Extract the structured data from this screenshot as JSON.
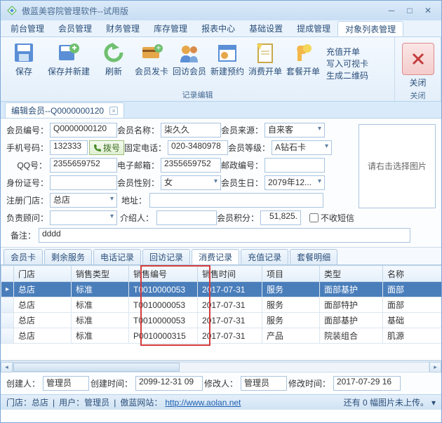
{
  "window": {
    "title": "傲蓝美容院管理软件--试用版"
  },
  "menu": [
    "前台管理",
    "会员管理",
    "财务管理",
    "库存管理",
    "报表中心",
    "基础设置",
    "提成管理",
    "对象列表管理"
  ],
  "menu_active": 7,
  "ribbon": {
    "group1_caption": "记录编辑",
    "buttons": [
      "保存",
      "保存并新建",
      "刷新",
      "会员发卡",
      "回访会员",
      "新建预约",
      "消费开单",
      "套餐开单"
    ],
    "stack": [
      "充值开单",
      "写入可视卡",
      "生成二维码"
    ],
    "close_caption": "关闭",
    "close_label": "关闭"
  },
  "doctab": {
    "title": "编辑会员--Q0000000120"
  },
  "form": {
    "labels": {
      "member_no": "会员编号：",
      "member_name": "会员名称：",
      "source": "会员来源：",
      "mobile": "手机号码：",
      "dial": "拨号",
      "phone": "固定电话：",
      "level": "会员等级：",
      "qq": "QQ号：",
      "email": "电子邮箱：",
      "zip": "邮政编号：",
      "idcard": "身份证号：",
      "gender": "会员性别：",
      "birthday": "会员生日：",
      "reg_store": "注册门店：",
      "address": "地址：",
      "consultant": "负责顾问：",
      "referrer": "介绍人：",
      "points": "会员积分：",
      "nosms": "不收短信",
      "remark": "备注："
    },
    "values": {
      "member_no": "Q0000000120",
      "member_name": "柒久久",
      "source": "自来客",
      "mobile": "132333",
      "phone": "020-3480978",
      "level": "A钻石卡",
      "qq": "2355659752",
      "email": "2355659752",
      "zip": "",
      "idcard": "",
      "gender": "女",
      "birthday": "2079年12...",
      "reg_store": "总店",
      "address": "",
      "consultant": "",
      "referrer": "",
      "points": "51,825.",
      "remark": "dddd"
    },
    "imgbox": "请右击选择图片"
  },
  "tabs": [
    "会员卡",
    "剩余服务",
    "电话记录",
    "回访记录",
    "消费记录",
    "充值记录",
    "套餐明细"
  ],
  "tabs_active": 4,
  "grid": {
    "columns": [
      "门店",
      "销售类型",
      "销售编号",
      "销售时间",
      "项目",
      "类型",
      "名称"
    ],
    "rows": [
      {
        "store": "总店",
        "stype": "标准",
        "sno": "T0010000053",
        "stime": "2017-07-31",
        "item": "服务",
        "cat": "面部基护",
        "name": "面部"
      },
      {
        "store": "总店",
        "stype": "标准",
        "sno": "T0010000053",
        "stime": "2017-07-31",
        "item": "服务",
        "cat": "面部特护",
        "name": "面部"
      },
      {
        "store": "总店",
        "stype": "标准",
        "sno": "T0010000053",
        "stime": "2017-07-31",
        "item": "服务",
        "cat": "面部基护",
        "name": "基础"
      },
      {
        "store": "总店",
        "stype": "标准",
        "sno": "P0010000315",
        "stime": "2017-07-31",
        "item": "产品",
        "cat": "院装组合",
        "name": "肌源"
      }
    ]
  },
  "footer": {
    "creator_lbl": "创建人：",
    "creator": "管理员",
    "ctime_lbl": "创建时间：",
    "ctime": "2099-12-31 09",
    "modifier_lbl": "修改人：",
    "modifier": "管理员",
    "mtime_lbl": "修改时间：",
    "mtime": "2017-07-29 16"
  },
  "status": {
    "store_lbl": "门店：",
    "store": "总店",
    "user_lbl": "用户：",
    "user": "管理员",
    "site_lbl": "傲蓝网站：",
    "site": "http://www.aolan.net",
    "upload": "还有 0 幅图片未上传。"
  }
}
